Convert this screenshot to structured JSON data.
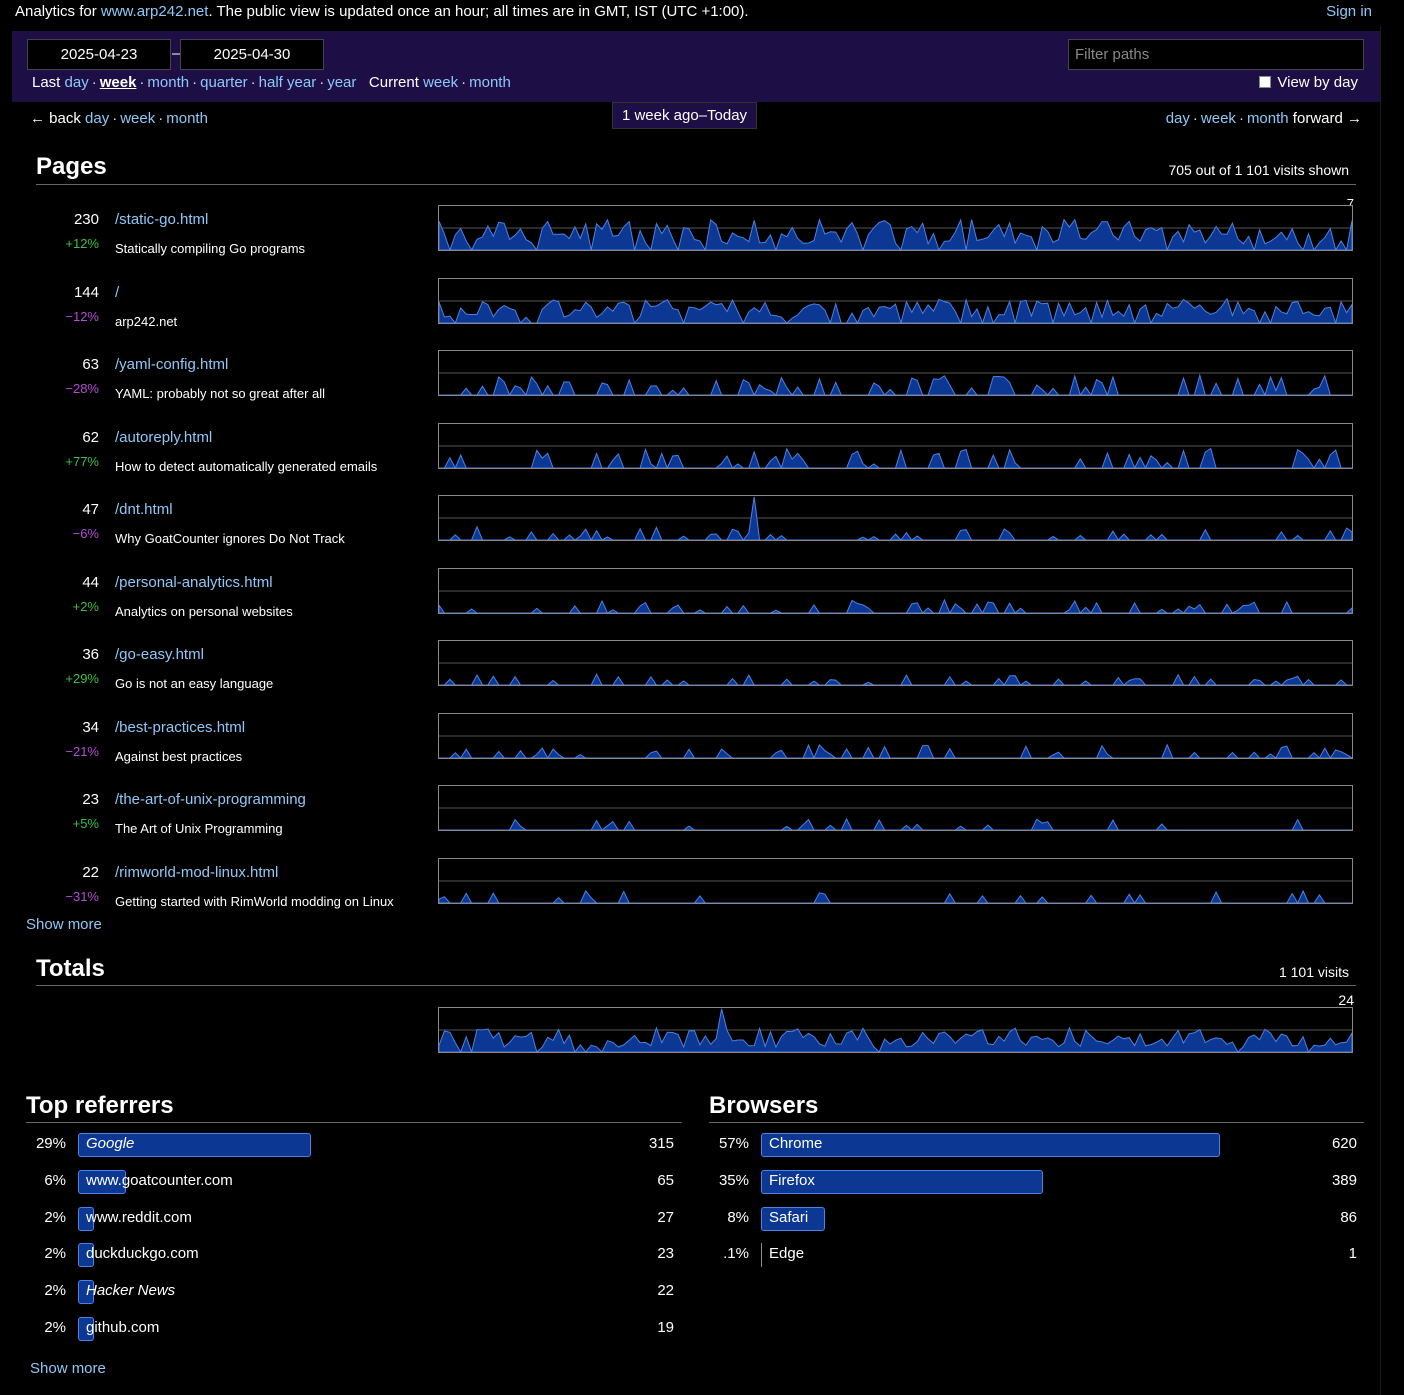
{
  "header": {
    "intro_prefix": "Analytics for ",
    "site_link": "www.arp242.net",
    "intro_suffix": ". The public view is updated once an hour; all times are in GMT, IST (UTC +1:00).",
    "signin": "Sign in"
  },
  "period": {
    "date_start": "2025-04-23",
    "date_sep": "–",
    "date_end": "2025-04-30",
    "filter_placeholder": "Filter paths",
    "last_label": "Last",
    "last_options": [
      "day",
      "week",
      "month",
      "quarter",
      "half year",
      "year"
    ],
    "active": "week",
    "current_label": "Current",
    "current_options": [
      "week",
      "month"
    ],
    "view_by_day": "View by day",
    "view_by_day_checked": false
  },
  "nav": {
    "back": "← back",
    "back_options": [
      "day",
      "week",
      "month"
    ],
    "current_period": "1 week ago–Today",
    "forward_options": [
      "day",
      "week",
      "month"
    ],
    "forward": "forward →"
  },
  "pages": {
    "title": "Pages",
    "summary": "705 out of 1 101 visits shown",
    "max_label": "7",
    "show_more": "Show more",
    "rows": [
      {
        "count": "230",
        "change": "+12%",
        "path": "/static-go.html",
        "title": "Statically compiling Go programs",
        "density": 0.9,
        "peak": 0.7
      },
      {
        "count": "144",
        "change": "−12%",
        "path": "/",
        "title": "arp242.net",
        "density": 0.75,
        "peak": 0.55
      },
      {
        "count": "63",
        "change": "−28%",
        "path": "/yaml-config.html",
        "title": "YAML: probably not so great after all",
        "density": 0.35,
        "peak": 0.45
      },
      {
        "count": "62",
        "change": "+77%",
        "path": "/autoreply.html",
        "title": "How to detect automatically generated emails",
        "density": 0.3,
        "peak": 0.45
      },
      {
        "count": "47",
        "change": "−6%",
        "path": "/dnt.html",
        "title": "Why GoatCounter ignores Do Not Track",
        "density": 0.25,
        "peak": 0.3
      },
      {
        "count": "44",
        "change": "+2%",
        "path": "/personal-analytics.html",
        "title": "Analytics on personal websites",
        "density": 0.28,
        "peak": 0.3
      },
      {
        "count": "36",
        "change": "+29%",
        "path": "/go-easy.html",
        "title": "Go is not an easy language",
        "density": 0.25,
        "peak": 0.25
      },
      {
        "count": "34",
        "change": "−21%",
        "path": "/best-practices.html",
        "title": "Against best practices",
        "density": 0.2,
        "peak": 0.3
      },
      {
        "count": "23",
        "change": "+5%",
        "path": "/the-art-of-unix-programming",
        "title": "The Art of Unix Programming",
        "density": 0.15,
        "peak": 0.28
      },
      {
        "count": "22",
        "change": "−31%",
        "path": "/rimworld-mod-linux.html",
        "title": "Getting started with RimWorld modding on Linux",
        "density": 0.14,
        "peak": 0.28
      }
    ]
  },
  "totals": {
    "title": "Totals",
    "summary": "1 101 visits",
    "max_label": "24"
  },
  "referrers": {
    "title": "Top referrers",
    "show_more": "Show more",
    "rows": [
      {
        "pct": "29%",
        "name": "Google",
        "italic": true,
        "count": "315",
        "fraction": 0.29
      },
      {
        "pct": "6%",
        "name": "www.goatcounter.com",
        "italic": false,
        "count": "65",
        "fraction": 0.06
      },
      {
        "pct": "2%",
        "name": "www.reddit.com",
        "italic": false,
        "count": "27",
        "fraction": 0.02
      },
      {
        "pct": "2%",
        "name": "duckduckgo.com",
        "italic": false,
        "count": "23",
        "fraction": 0.02
      },
      {
        "pct": "2%",
        "name": "Hacker News",
        "italic": true,
        "count": "22",
        "fraction": 0.02
      },
      {
        "pct": "2%",
        "name": "github.com",
        "italic": false,
        "count": "19",
        "fraction": 0.02
      }
    ]
  },
  "browsers": {
    "title": "Browsers",
    "rows": [
      {
        "pct": "57%",
        "name": "Chrome",
        "count": "620",
        "fraction": 0.57
      },
      {
        "pct": "35%",
        "name": "Firefox",
        "count": "389",
        "fraction": 0.35
      },
      {
        "pct": "8%",
        "name": "Safari",
        "count": "86",
        "fraction": 0.08
      },
      {
        "pct": ".1%",
        "name": "Edge",
        "count": "1",
        "fraction": 0.001
      }
    ]
  },
  "colors": {
    "accent_link": "#8ec8f7",
    "period_bar": "#1d0f46",
    "chart_fill": "#0c3792",
    "chart_stroke": "#4a82e6",
    "positive": "#3dbf47",
    "negative": "#b44cd6"
  }
}
